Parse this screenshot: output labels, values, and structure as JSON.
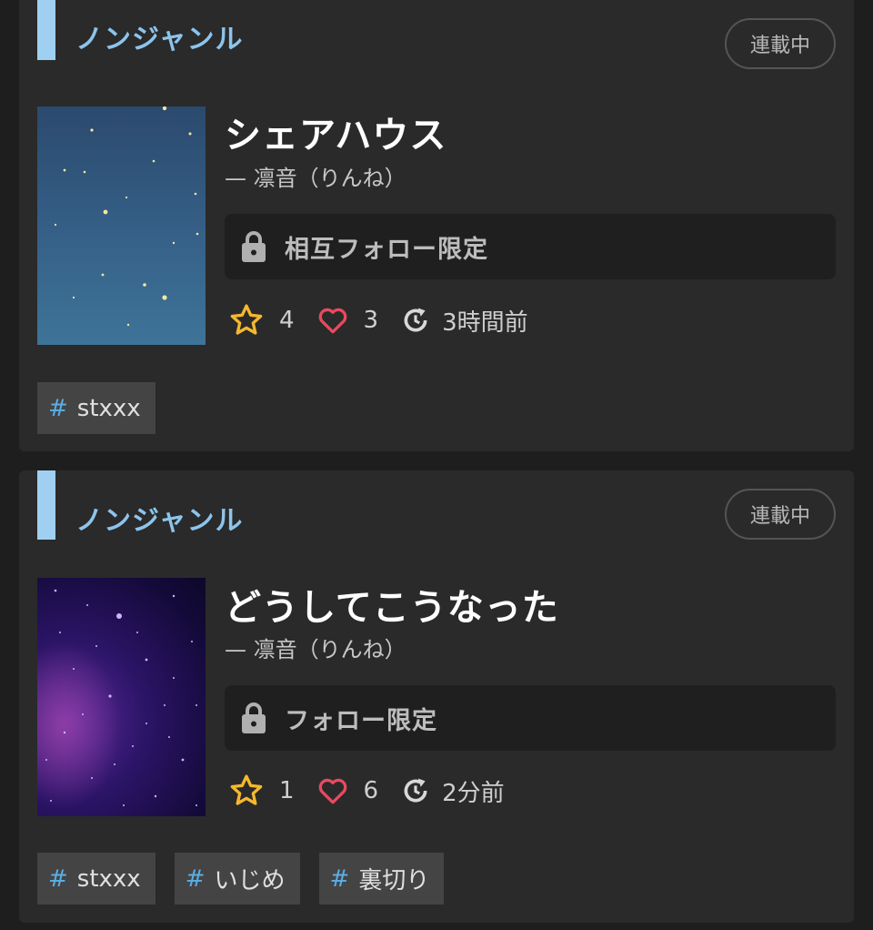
{
  "works": [
    {
      "genre": "ノンジャンル",
      "status": "連載中",
      "title": "シェアハウス",
      "author": "— 凛音（りんね）",
      "restriction": "相互フォロー限定",
      "stars": "4",
      "likes": "3",
      "updated": "3時間前",
      "tags": [
        "stxxx"
      ]
    },
    {
      "genre": "ノンジャンル",
      "status": "連載中",
      "title": "どうしてこうなった",
      "author": "— 凛音（りんね）",
      "restriction": "フォロー限定",
      "stars": "1",
      "likes": "6",
      "updated": "2分前",
      "tags": [
        "stxxx",
        "いじめ",
        "裏切り"
      ]
    }
  ],
  "tag_prefix": "#",
  "icons": {
    "lock": "lock-icon",
    "star": "star-icon",
    "heart": "heart-icon",
    "update": "history-icon"
  },
  "colors": {
    "accent_blue": "#8cc4ec",
    "star": "#f5b82e",
    "heart": "#e84a5f",
    "hash": "#5aaee6"
  }
}
